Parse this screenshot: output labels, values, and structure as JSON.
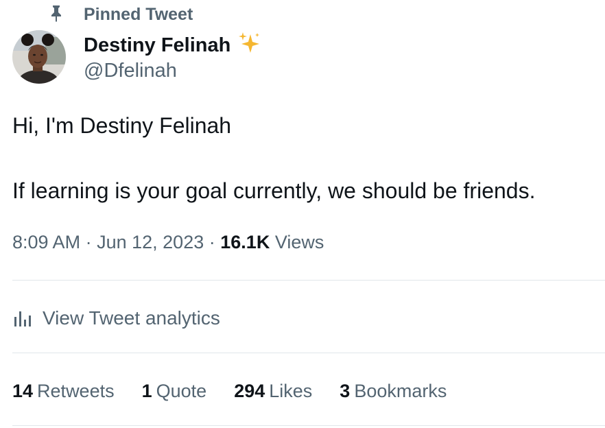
{
  "pinned": {
    "label": "Pinned Tweet",
    "icon": "pin-icon"
  },
  "author": {
    "display_name": "Destiny Felinah",
    "name_emoji": "sparkles-icon",
    "handle": "@Dfelinah",
    "avatar": "avatar"
  },
  "tweet": {
    "line1": "Hi, I'm Destiny Felinah",
    "line2": "If learning is your goal currently, we should be friends."
  },
  "meta": {
    "time": "8:09 AM",
    "separator": "·",
    "date": "Jun 12, 2023",
    "views_count": "16.1K",
    "views_label": "Views"
  },
  "analytics": {
    "label": "View Tweet analytics",
    "icon": "bar-chart-icon"
  },
  "stats": [
    {
      "count": "14",
      "label": "Retweets"
    },
    {
      "count": "1",
      "label": "Quote"
    },
    {
      "count": "294",
      "label": "Likes"
    },
    {
      "count": "3",
      "label": "Bookmarks"
    }
  ],
  "colors": {
    "primary_text": "#0f1419",
    "secondary_text": "#536471",
    "divider": "#e1e6ea",
    "sparkle": "#f5b731"
  }
}
